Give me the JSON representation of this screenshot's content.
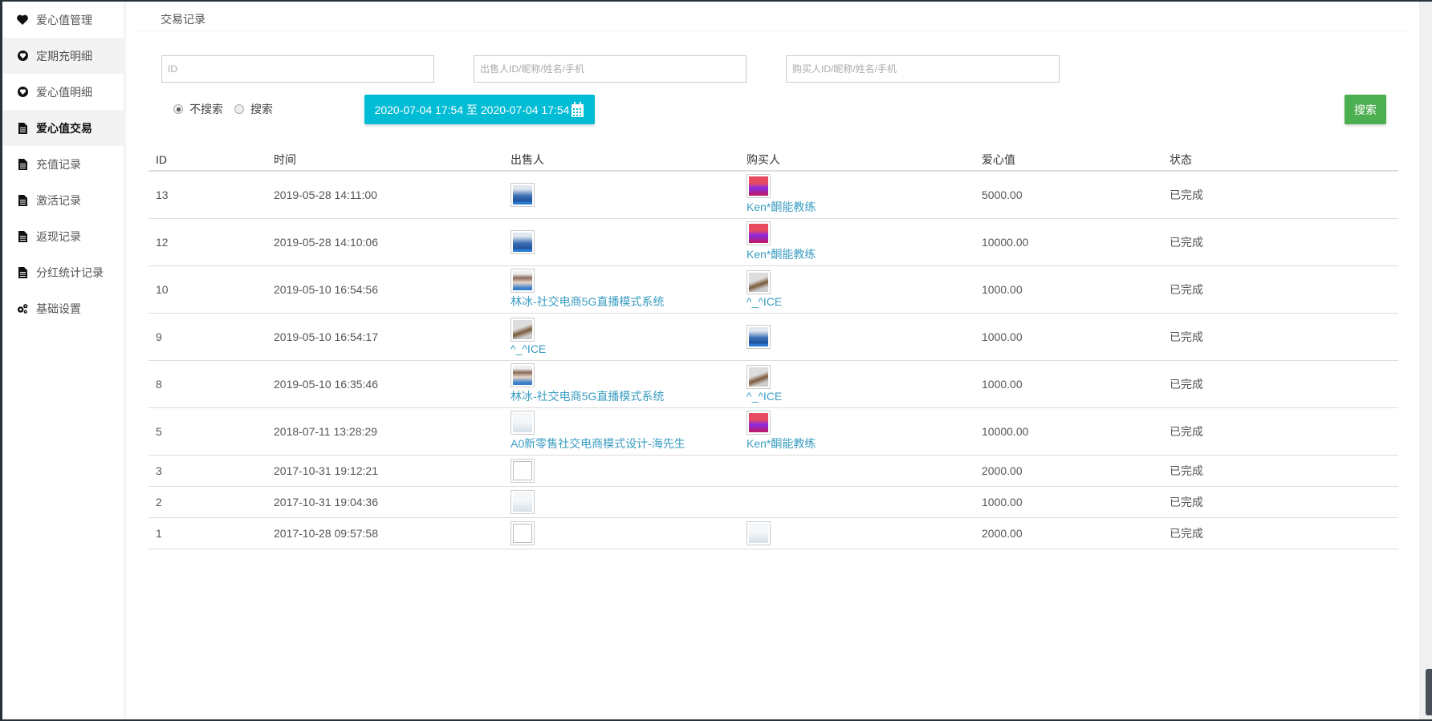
{
  "sidebar": {
    "items": [
      {
        "label": "爱心值管理",
        "icon": "heart-icon"
      },
      {
        "label": "定期充明细",
        "icon": "heart-circle-icon"
      },
      {
        "label": "爱心值明细",
        "icon": "heart-circle-icon"
      },
      {
        "label": "爱心值交易",
        "icon": "file-icon"
      },
      {
        "label": "充值记录",
        "icon": "file-icon"
      },
      {
        "label": "激活记录",
        "icon": "file-icon"
      },
      {
        "label": "返现记录",
        "icon": "file-icon"
      },
      {
        "label": "分红统计记录",
        "icon": "file-icon"
      },
      {
        "label": "基础设置",
        "icon": "gears-icon"
      }
    ],
    "selected": "爱心值交易"
  },
  "header": {
    "title": "交易记录"
  },
  "filters": {
    "id_placeholder": "ID",
    "seller_placeholder": "出售人ID/昵称/姓名/手机",
    "buyer_placeholder": "购买人ID/昵称/姓名/手机",
    "radio_no": "不搜索",
    "radio_yes": "搜索",
    "radio_selected": "不搜索",
    "date_range": "2020-07-04 17:54 至 2020-07-04 17:54",
    "search_label": "搜索"
  },
  "colors": {
    "date_button": "#00bcd4",
    "search_button": "#4caf50",
    "link": "#3a9dc2"
  },
  "table": {
    "headers": [
      "ID",
      "时间",
      "出售人",
      "购买人",
      "爱心值",
      "状态"
    ],
    "rows": [
      {
        "id": "13",
        "time": "2019-05-28 14:11:00",
        "seller": {
          "avatar": "man-photo",
          "name": ""
        },
        "buyer": {
          "avatar": "ken-photo",
          "name": "Ken*酮能教练"
        },
        "value": "5000.00",
        "status": "已完成"
      },
      {
        "id": "12",
        "time": "2019-05-28 14:10:06",
        "seller": {
          "avatar": "man-photo",
          "name": ""
        },
        "buyer": {
          "avatar": "ken-photo",
          "name": "Ken*酮能教练"
        },
        "value": "10000.00",
        "status": "已完成"
      },
      {
        "id": "10",
        "time": "2019-05-10 16:54:56",
        "seller": {
          "avatar": "woman-photo",
          "name": "林冰-社交电商5G直播模式系统"
        },
        "buyer": {
          "avatar": "coffee-photo",
          "name": "^_^ICE"
        },
        "value": "1000.00",
        "status": "已完成"
      },
      {
        "id": "9",
        "time": "2019-05-10 16:54:17",
        "seller": {
          "avatar": "coffee-photo",
          "name": "^_^ICE"
        },
        "buyer": {
          "avatar": "man-photo",
          "name": ""
        },
        "value": "1000.00",
        "status": "已完成"
      },
      {
        "id": "8",
        "time": "2019-05-10 16:35:46",
        "seller": {
          "avatar": "woman-photo",
          "name": "林冰-社交电商5G直播模式系统"
        },
        "buyer": {
          "avatar": "coffee-photo",
          "name": "^_^ICE"
        },
        "value": "1000.00",
        "status": "已完成"
      },
      {
        "id": "5",
        "time": "2018-07-11 13:28:29",
        "seller": {
          "avatar": "placeholder-image",
          "name": "A0新零售社交电商模式设计-海先生"
        },
        "buyer": {
          "avatar": "ken-photo",
          "name": "Ken*酮能教练"
        },
        "value": "10000.00",
        "status": "已完成"
      },
      {
        "id": "3",
        "time": "2017-10-31 19:12:21",
        "seller": {
          "avatar": "broken-image",
          "name": ""
        },
        "buyer": null,
        "value": "2000.00",
        "status": "已完成"
      },
      {
        "id": "2",
        "time": "2017-10-31 19:04:36",
        "seller": {
          "avatar": "placeholder-image",
          "name": ""
        },
        "buyer": null,
        "value": "1000.00",
        "status": "已完成"
      },
      {
        "id": "1",
        "time": "2017-10-28 09:57:58",
        "seller": {
          "avatar": "broken-image",
          "name": ""
        },
        "buyer": {
          "avatar": "placeholder-image",
          "name": ""
        },
        "value": "2000.00",
        "status": "已完成"
      }
    ]
  }
}
